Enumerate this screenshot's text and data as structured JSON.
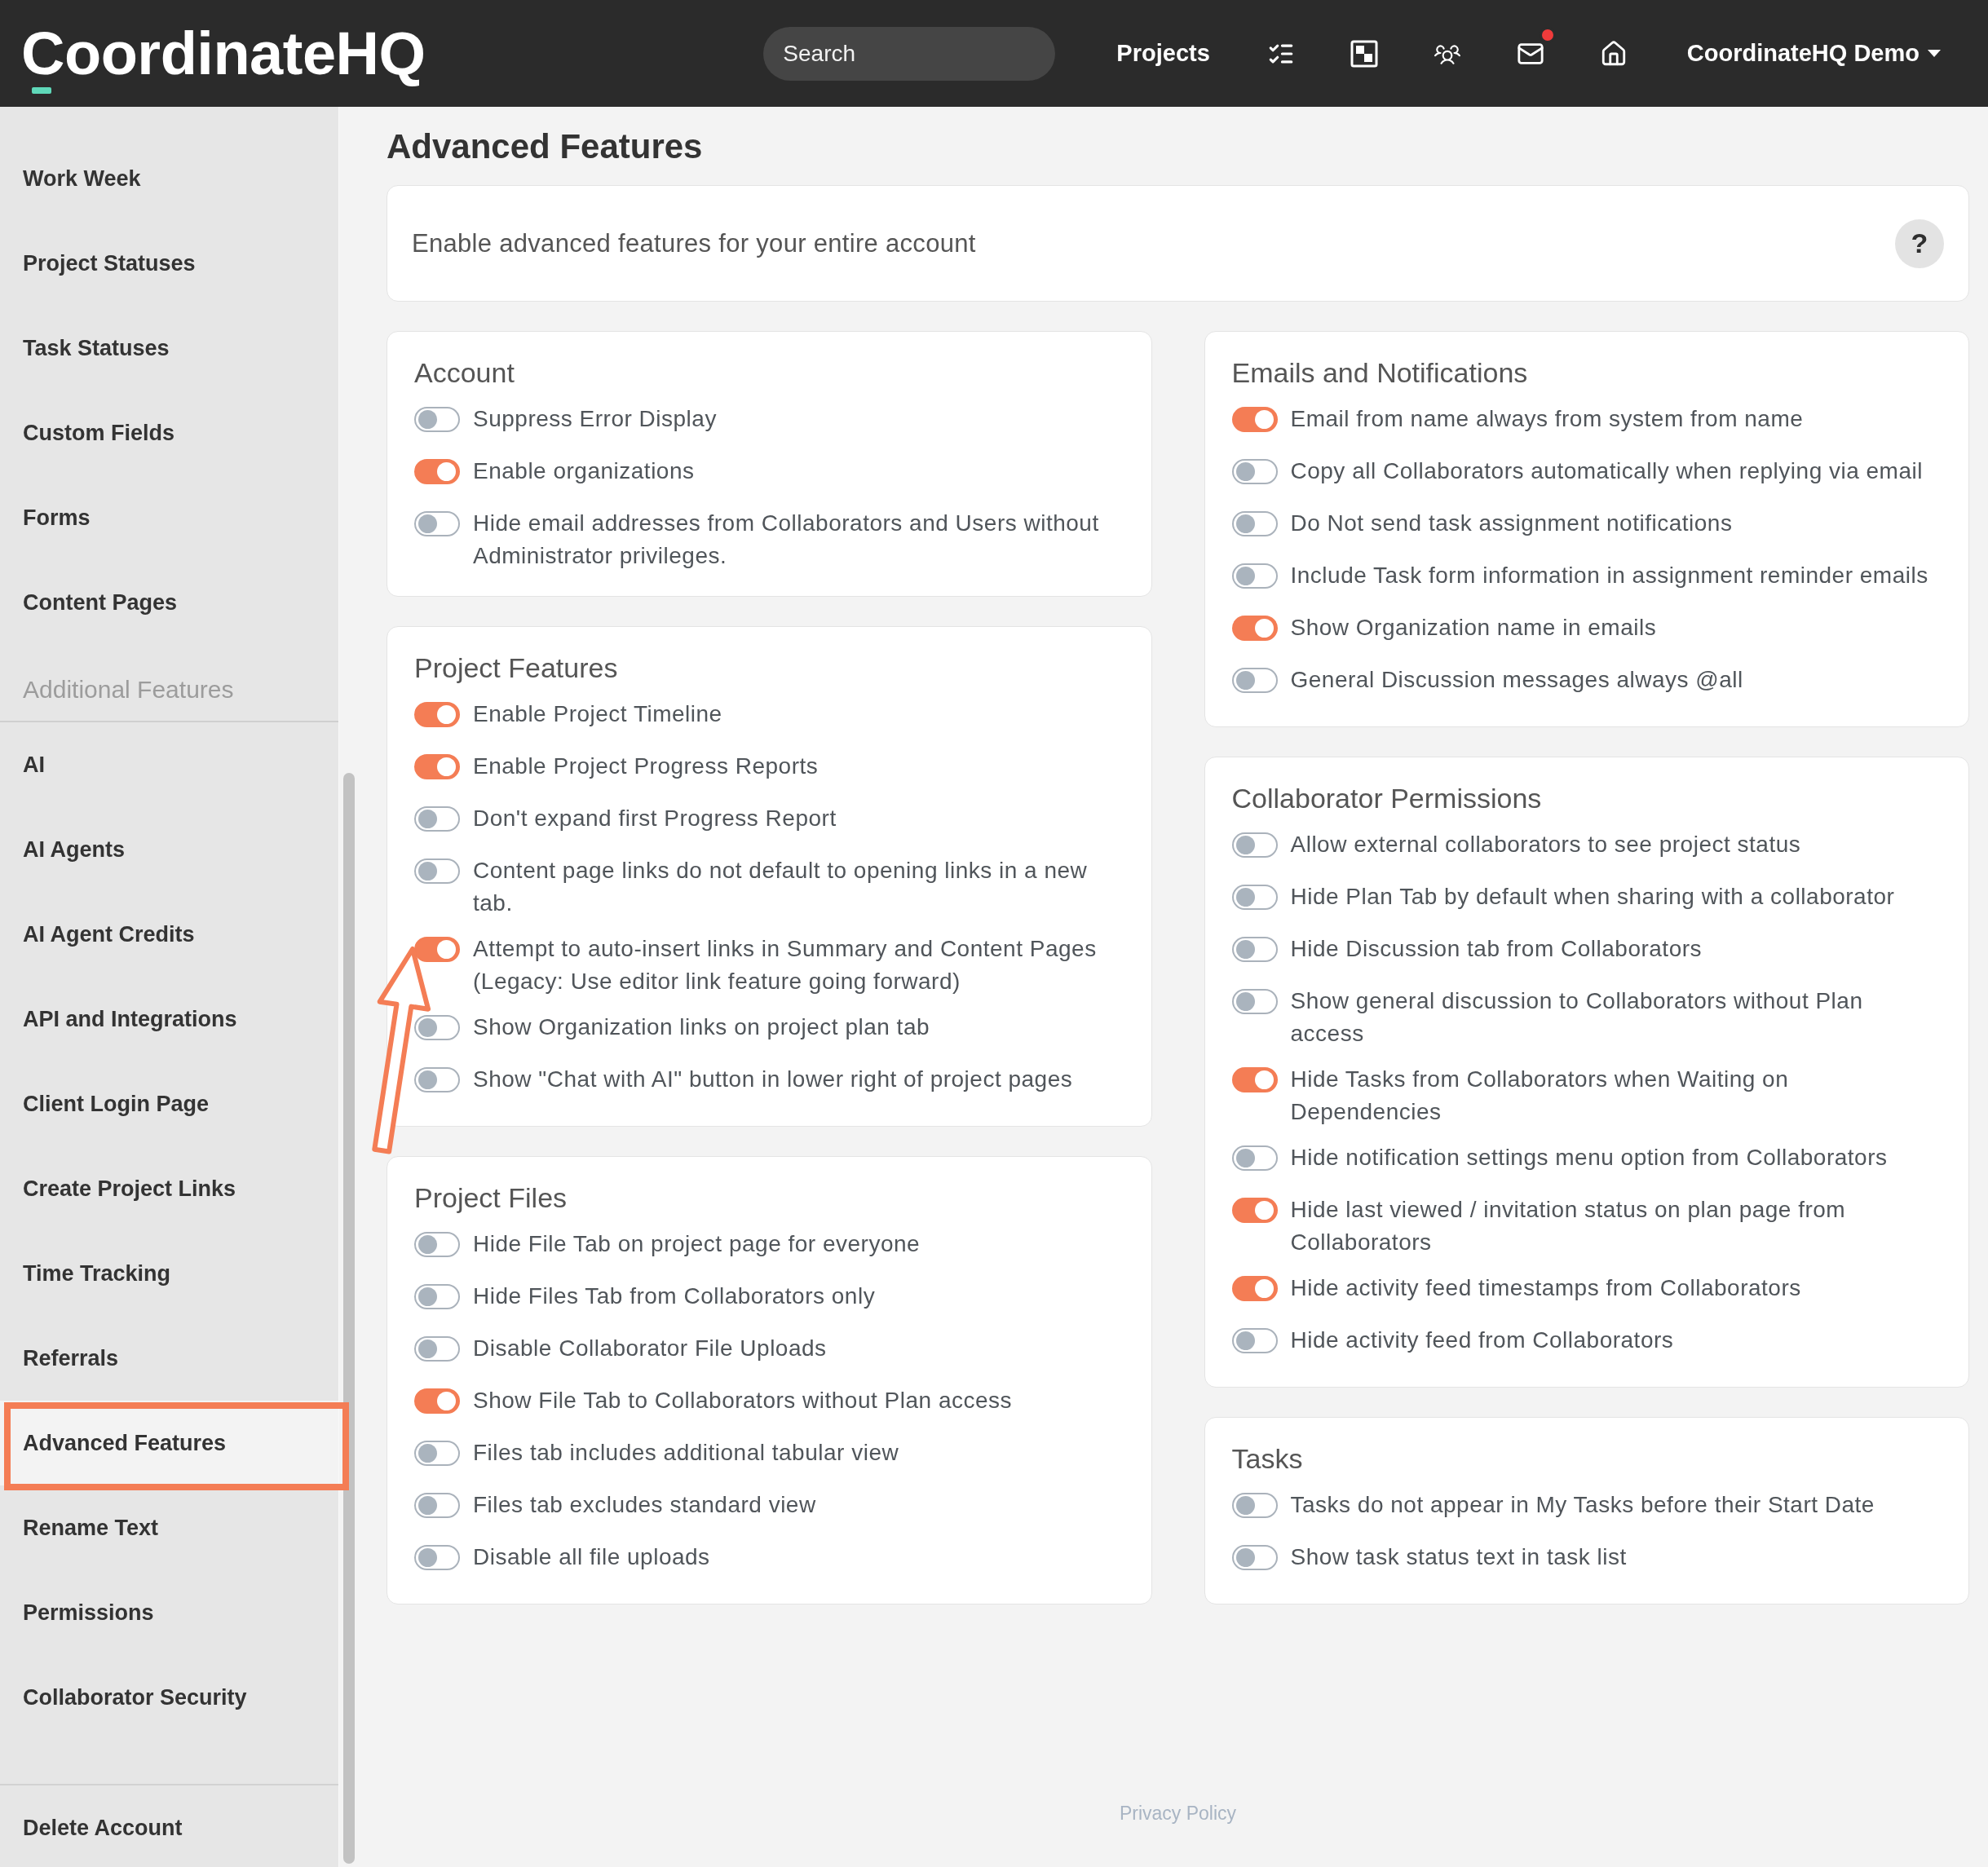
{
  "header": {
    "logo": "CoordinateHQ",
    "search": {
      "placeholder": "Search"
    },
    "nav_link": "Projects",
    "mail_notification": true,
    "account_menu": "CoordinateHQ Demo"
  },
  "sidebar": {
    "groups": [
      {
        "items": [
          {
            "label": "Work Week",
            "selected": false,
            "highlighted": false
          },
          {
            "label": "Project Statuses",
            "selected": false,
            "highlighted": false
          },
          {
            "label": "Task Statuses",
            "selected": false,
            "highlighted": false
          },
          {
            "label": "Custom Fields",
            "selected": false,
            "highlighted": false
          },
          {
            "label": "Forms",
            "selected": false,
            "highlighted": false
          },
          {
            "label": "Content Pages",
            "selected": false,
            "highlighted": false
          }
        ]
      },
      {
        "heading": "Additional Features",
        "items": [
          {
            "label": "AI",
            "selected": false,
            "highlighted": false
          },
          {
            "label": "AI Agents",
            "selected": false,
            "highlighted": false
          },
          {
            "label": "AI Agent Credits",
            "selected": false,
            "highlighted": false
          },
          {
            "label": "API and Integrations",
            "selected": false,
            "highlighted": false
          },
          {
            "label": "Client Login Page",
            "selected": false,
            "highlighted": false
          },
          {
            "label": "Create Project Links",
            "selected": false,
            "highlighted": false
          },
          {
            "label": "Time Tracking",
            "selected": false,
            "highlighted": false
          },
          {
            "label": "Referrals",
            "selected": false,
            "highlighted": false
          },
          {
            "label": "Advanced Features",
            "selected": true,
            "highlighted": true
          },
          {
            "label": "Rename Text",
            "selected": false,
            "highlighted": false
          },
          {
            "label": "Permissions",
            "selected": false,
            "highlighted": false
          },
          {
            "label": "Collaborator Security",
            "selected": false,
            "highlighted": false
          }
        ]
      },
      {
        "items": [
          {
            "label": "Delete Account",
            "selected": false,
            "highlighted": false
          }
        ]
      }
    ]
  },
  "page_title": "Advanced Features",
  "intro": {
    "text": "Enable advanced features for your entire account",
    "help": "?"
  },
  "columns": [
    {
      "cards": [
        {
          "title": "Account",
          "settings": [
            {
              "label": "Suppress Error Display",
              "on": false,
              "pointed_at": false
            },
            {
              "label": "Enable organizations",
              "on": true,
              "pointed_at": false
            },
            {
              "label": "Hide email addresses from Collaborators and Users without Administrator privileges.",
              "on": false,
              "pointed_at": false
            }
          ]
        },
        {
          "title": "Project Features",
          "settings": [
            {
              "label": "Enable Project Timeline",
              "on": true,
              "pointed_at": false
            },
            {
              "label": "Enable Project Progress Reports",
              "on": true,
              "pointed_at": false
            },
            {
              "label": "Don't expand first Progress Report",
              "on": false,
              "pointed_at": false
            },
            {
              "label": "Content page links do not default to opening links in a new tab.",
              "on": false,
              "pointed_at": false
            },
            {
              "label": "Attempt to auto-insert links in Summary and Content Pages (Legacy: Use editor link feature going forward)",
              "on": true,
              "pointed_at": true
            },
            {
              "label": "Show Organization links on project plan tab",
              "on": false,
              "pointed_at": false
            },
            {
              "label": "Show \"Chat with AI\" button in lower right of project pages",
              "on": false,
              "pointed_at": false
            }
          ]
        },
        {
          "title": "Project Files",
          "settings": [
            {
              "label": "Hide File Tab on project page for everyone",
              "on": false,
              "pointed_at": false
            },
            {
              "label": "Hide Files Tab from Collaborators only",
              "on": false,
              "pointed_at": false
            },
            {
              "label": "Disable Collaborator File Uploads",
              "on": false,
              "pointed_at": false
            },
            {
              "label": "Show File Tab to Collaborators without Plan access",
              "on": true,
              "pointed_at": false
            },
            {
              "label": "Files tab includes additional tabular view",
              "on": false,
              "pointed_at": false
            },
            {
              "label": "Files tab excludes standard view",
              "on": false,
              "pointed_at": false
            },
            {
              "label": "Disable all file uploads",
              "on": false,
              "pointed_at": false
            }
          ]
        }
      ]
    },
    {
      "cards": [
        {
          "title": "Emails and Notifications",
          "settings": [
            {
              "label": "Email from name always from system from name",
              "on": true,
              "pointed_at": false
            },
            {
              "label": "Copy all Collaborators automatically when replying via email",
              "on": false,
              "pointed_at": false
            },
            {
              "label": "Do Not send task assignment notifications",
              "on": false,
              "pointed_at": false
            },
            {
              "label": "Include Task form information in assignment reminder emails",
              "on": false,
              "pointed_at": false
            },
            {
              "label": "Show Organization name in emails",
              "on": true,
              "pointed_at": false
            },
            {
              "label": "General Discussion messages always @all",
              "on": false,
              "pointed_at": false
            }
          ]
        },
        {
          "title": "Collaborator Permissions",
          "settings": [
            {
              "label": "Allow external collaborators to see project status",
              "on": false,
              "pointed_at": false
            },
            {
              "label": "Hide Plan Tab by default when sharing with a collaborator",
              "on": false,
              "pointed_at": false
            },
            {
              "label": "Hide Discussion tab from Collaborators",
              "on": false,
              "pointed_at": false
            },
            {
              "label": "Show general discussion to Collaborators without Plan access",
              "on": false,
              "pointed_at": false
            },
            {
              "label": "Hide Tasks from Collaborators when Waiting on Dependencies",
              "on": true,
              "pointed_at": false
            },
            {
              "label": "Hide notification settings menu option from Collaborators",
              "on": false,
              "pointed_at": false
            },
            {
              "label": "Hide last viewed / invitation status on plan page from Collaborators",
              "on": true,
              "pointed_at": false
            },
            {
              "label": "Hide activity feed timestamps from Collaborators",
              "on": true,
              "pointed_at": false
            },
            {
              "label": "Hide activity feed from Collaborators",
              "on": false,
              "pointed_at": false
            }
          ]
        },
        {
          "title": "Tasks",
          "settings": [
            {
              "label": "Tasks do not appear in My Tasks before their Start Date",
              "on": false,
              "pointed_at": false
            },
            {
              "label": "Show task status text in task list",
              "on": false,
              "pointed_at": false
            }
          ]
        }
      ]
    }
  ],
  "footer": {
    "link": "Privacy Policy"
  }
}
